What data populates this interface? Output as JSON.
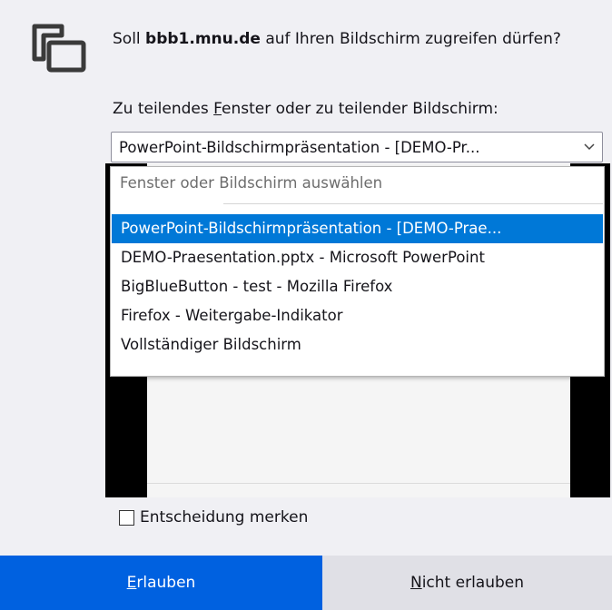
{
  "prompt": {
    "prefix": "Soll ",
    "host": "bbb1.mnu.de",
    "suffix": " auf Ihren Bildschirm zugreifen dürfen?"
  },
  "select_label": {
    "pre": "Zu teilendes ",
    "access": "F",
    "post": "enster oder zu teilender Bildschirm:"
  },
  "select": {
    "value": "PowerPoint-Bildschirmpräsentation - [DEMO-Pr..."
  },
  "dropdown": {
    "placeholder": "Fenster oder Bildschirm auswählen",
    "options": [
      "PowerPoint-Bildschirmpräsentation - [DEMO-Prae...",
      "DEMO-Praesentation.pptx - Microsoft PowerPoint",
      "BigBlueButton - test - Mozilla Firefox",
      "Firefox - Weitergabe-Indikator",
      "Vollständiger Bildschirm"
    ]
  },
  "remember": {
    "label": "Entscheidung merken",
    "checked": false
  },
  "buttons": {
    "allow_access": "E",
    "allow_rest": "rlauben",
    "deny_access": "N",
    "deny_rest": "icht erlauben"
  },
  "colors": {
    "accent": "#0061e0",
    "selection": "#0078d7",
    "background": "#f0f0f4"
  },
  "icons": {
    "header": "screen-share-icon",
    "select": "chevron-down-icon"
  }
}
